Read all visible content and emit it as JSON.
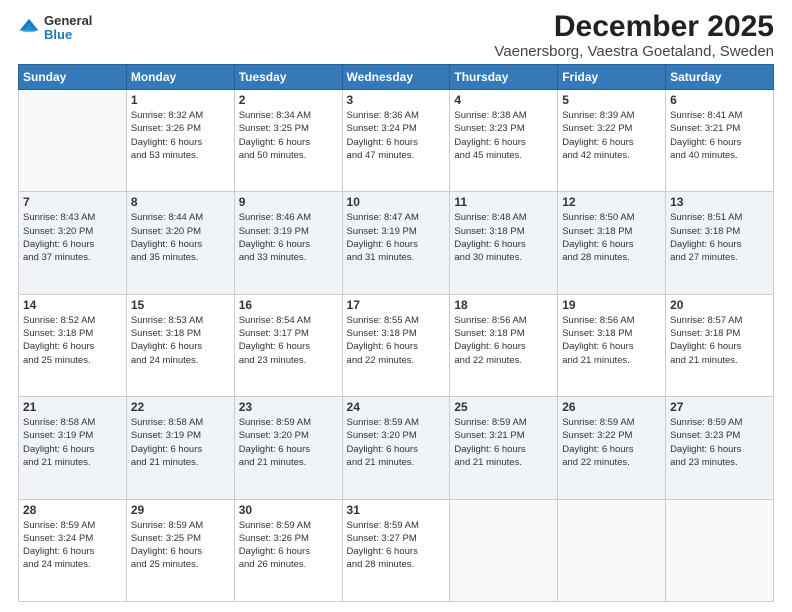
{
  "header": {
    "logo": {
      "general": "General",
      "blue": "Blue"
    },
    "title": "December 2025",
    "subtitle": "Vaenersborg, Vaestra Goetaland, Sweden"
  },
  "weekdays": [
    "Sunday",
    "Monday",
    "Tuesday",
    "Wednesday",
    "Thursday",
    "Friday",
    "Saturday"
  ],
  "weeks": [
    [
      {
        "day": "",
        "info": ""
      },
      {
        "day": "1",
        "info": "Sunrise: 8:32 AM\nSunset: 3:26 PM\nDaylight: 6 hours\nand 53 minutes."
      },
      {
        "day": "2",
        "info": "Sunrise: 8:34 AM\nSunset: 3:25 PM\nDaylight: 6 hours\nand 50 minutes."
      },
      {
        "day": "3",
        "info": "Sunrise: 8:36 AM\nSunset: 3:24 PM\nDaylight: 6 hours\nand 47 minutes."
      },
      {
        "day": "4",
        "info": "Sunrise: 8:38 AM\nSunset: 3:23 PM\nDaylight: 6 hours\nand 45 minutes."
      },
      {
        "day": "5",
        "info": "Sunrise: 8:39 AM\nSunset: 3:22 PM\nDaylight: 6 hours\nand 42 minutes."
      },
      {
        "day": "6",
        "info": "Sunrise: 8:41 AM\nSunset: 3:21 PM\nDaylight: 6 hours\nand 40 minutes."
      }
    ],
    [
      {
        "day": "7",
        "info": "Sunrise: 8:43 AM\nSunset: 3:20 PM\nDaylight: 6 hours\nand 37 minutes."
      },
      {
        "day": "8",
        "info": "Sunrise: 8:44 AM\nSunset: 3:20 PM\nDaylight: 6 hours\nand 35 minutes."
      },
      {
        "day": "9",
        "info": "Sunrise: 8:46 AM\nSunset: 3:19 PM\nDaylight: 6 hours\nand 33 minutes."
      },
      {
        "day": "10",
        "info": "Sunrise: 8:47 AM\nSunset: 3:19 PM\nDaylight: 6 hours\nand 31 minutes."
      },
      {
        "day": "11",
        "info": "Sunrise: 8:48 AM\nSunset: 3:18 PM\nDaylight: 6 hours\nand 30 minutes."
      },
      {
        "day": "12",
        "info": "Sunrise: 8:50 AM\nSunset: 3:18 PM\nDaylight: 6 hours\nand 28 minutes."
      },
      {
        "day": "13",
        "info": "Sunrise: 8:51 AM\nSunset: 3:18 PM\nDaylight: 6 hours\nand 27 minutes."
      }
    ],
    [
      {
        "day": "14",
        "info": "Sunrise: 8:52 AM\nSunset: 3:18 PM\nDaylight: 6 hours\nand 25 minutes."
      },
      {
        "day": "15",
        "info": "Sunrise: 8:53 AM\nSunset: 3:18 PM\nDaylight: 6 hours\nand 24 minutes."
      },
      {
        "day": "16",
        "info": "Sunrise: 8:54 AM\nSunset: 3:17 PM\nDaylight: 6 hours\nand 23 minutes."
      },
      {
        "day": "17",
        "info": "Sunrise: 8:55 AM\nSunset: 3:18 PM\nDaylight: 6 hours\nand 22 minutes."
      },
      {
        "day": "18",
        "info": "Sunrise: 8:56 AM\nSunset: 3:18 PM\nDaylight: 6 hours\nand 22 minutes."
      },
      {
        "day": "19",
        "info": "Sunrise: 8:56 AM\nSunset: 3:18 PM\nDaylight: 6 hours\nand 21 minutes."
      },
      {
        "day": "20",
        "info": "Sunrise: 8:57 AM\nSunset: 3:18 PM\nDaylight: 6 hours\nand 21 minutes."
      }
    ],
    [
      {
        "day": "21",
        "info": "Sunrise: 8:58 AM\nSunset: 3:19 PM\nDaylight: 6 hours\nand 21 minutes."
      },
      {
        "day": "22",
        "info": "Sunrise: 8:58 AM\nSunset: 3:19 PM\nDaylight: 6 hours\nand 21 minutes."
      },
      {
        "day": "23",
        "info": "Sunrise: 8:59 AM\nSunset: 3:20 PM\nDaylight: 6 hours\nand 21 minutes."
      },
      {
        "day": "24",
        "info": "Sunrise: 8:59 AM\nSunset: 3:20 PM\nDaylight: 6 hours\nand 21 minutes."
      },
      {
        "day": "25",
        "info": "Sunrise: 8:59 AM\nSunset: 3:21 PM\nDaylight: 6 hours\nand 21 minutes."
      },
      {
        "day": "26",
        "info": "Sunrise: 8:59 AM\nSunset: 3:22 PM\nDaylight: 6 hours\nand 22 minutes."
      },
      {
        "day": "27",
        "info": "Sunrise: 8:59 AM\nSunset: 3:23 PM\nDaylight: 6 hours\nand 23 minutes."
      }
    ],
    [
      {
        "day": "28",
        "info": "Sunrise: 8:59 AM\nSunset: 3:24 PM\nDaylight: 6 hours\nand 24 minutes."
      },
      {
        "day": "29",
        "info": "Sunrise: 8:59 AM\nSunset: 3:25 PM\nDaylight: 6 hours\nand 25 minutes."
      },
      {
        "day": "30",
        "info": "Sunrise: 8:59 AM\nSunset: 3:26 PM\nDaylight: 6 hours\nand 26 minutes."
      },
      {
        "day": "31",
        "info": "Sunrise: 8:59 AM\nSunset: 3:27 PM\nDaylight: 6 hours\nand 28 minutes."
      },
      {
        "day": "",
        "info": ""
      },
      {
        "day": "",
        "info": ""
      },
      {
        "day": "",
        "info": ""
      }
    ]
  ]
}
